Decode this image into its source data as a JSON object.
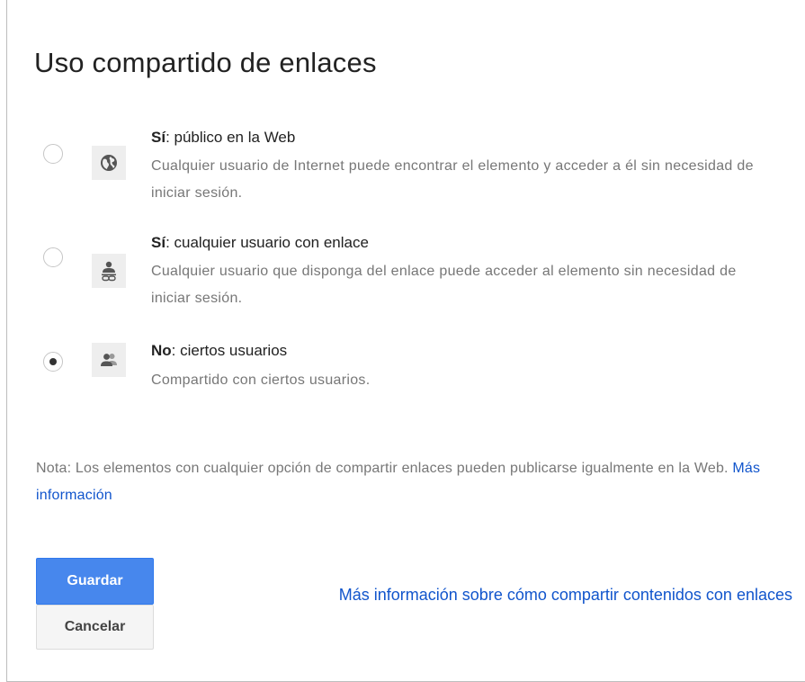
{
  "dialog": {
    "title": "Uso compartido de enlaces"
  },
  "options": [
    {
      "id": "public",
      "title_bold": "Sí",
      "title_rest": ": público en la Web",
      "description": "Cualquier usuario de Internet puede encontrar el elemento y acceder a él sin necesidad de iniciar sesión.",
      "icon": "globe-icon",
      "selected": false
    },
    {
      "id": "anyone-with-link",
      "title_bold": "Sí",
      "title_rest": ": cualquier usuario con enlace",
      "description": "Cualquier usuario que disponga del enlace puede acceder al elemento sin necesidad de iniciar sesión.",
      "icon": "person-link-icon",
      "selected": false
    },
    {
      "id": "specific-users",
      "title_bold": "No",
      "title_rest": ": ciertos usuarios",
      "description": "Compartido con ciertos usuarios.",
      "icon": "people-icon",
      "selected": true
    }
  ],
  "note": {
    "text": "Nota: Los elementos con cualquier opción de compartir enlaces pueden publicarse igualmente en la Web. ",
    "link_label": "Más información"
  },
  "buttons": {
    "save_label": "Guardar",
    "cancel_label": "Cancelar"
  },
  "help_link": {
    "label": "Más información sobre cómo compartir contenidos con enlaces"
  },
  "colors": {
    "primary_button": "#4787ed",
    "link": "#1155cc",
    "muted_text": "#777777"
  }
}
